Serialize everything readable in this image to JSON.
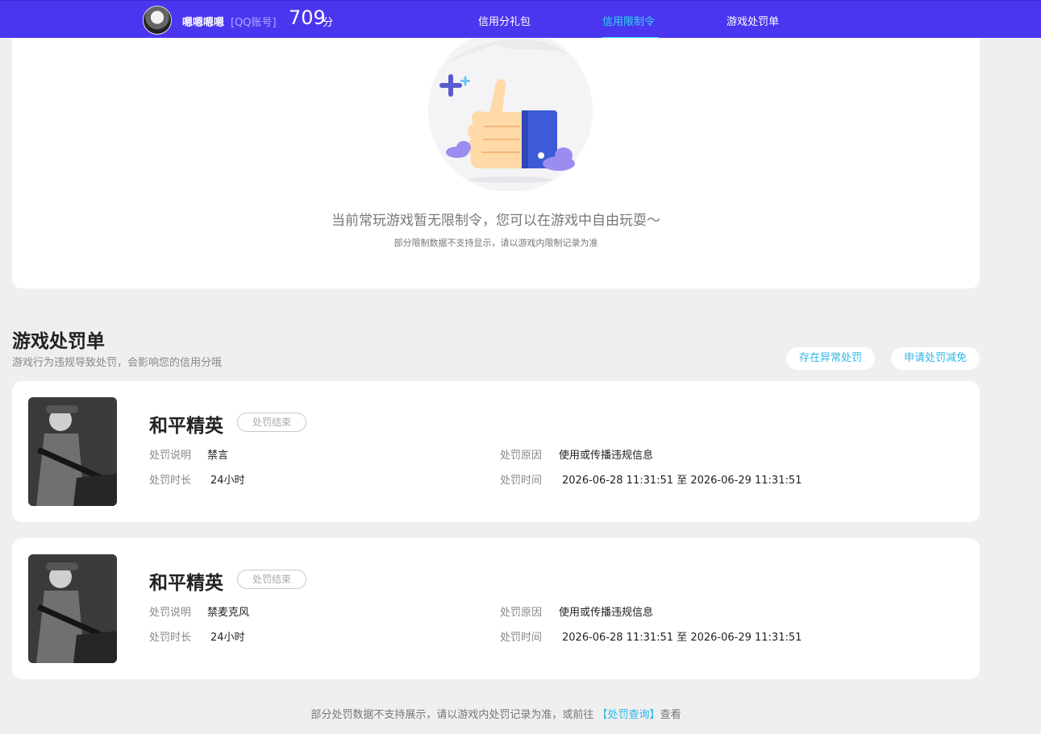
{
  "header": {
    "nickname": "嗯嗯嗯嗯",
    "account_type": "[QQ账号]",
    "score": "709",
    "score_unit": "分",
    "tabs": [
      {
        "label": "信用分礼包",
        "active": false
      },
      {
        "label": "信用限制令",
        "active": true
      },
      {
        "label": "游戏处罚单",
        "active": false
      }
    ]
  },
  "empty_state": {
    "title": "当前常玩游戏暂无限制令，您可以在游戏中自由玩耍～",
    "subtitle": "部分限制数据不支持显示，请以游戏内限制记录为准"
  },
  "penalty_section": {
    "title": "游戏处罚单",
    "subtitle": "游戏行为违规导致处罚，会影响您的信用分哦",
    "buttons": {
      "abnormal": "存在异常处罚",
      "reduce": "申请处罚减免"
    },
    "labels": {
      "desc": "处罚说明",
      "duration": "处罚时长",
      "reason": "处罚原因",
      "time": "处罚时间"
    },
    "items": [
      {
        "game": "和平精英",
        "status": "处罚结束",
        "desc": "禁言",
        "duration": "24小时",
        "reason": "使用或传播违规信息",
        "time": "2026-06-28 11:31:51 至 2026-06-29 11:31:51"
      },
      {
        "game": "和平精英",
        "status": "处罚结束",
        "desc": "禁麦克风",
        "duration": "24小时",
        "reason": "使用或传播违规信息",
        "time": "2026-06-28 11:31:51 至 2026-06-29 11:31:51"
      }
    ]
  },
  "footer": {
    "prefix": "部分处罚数据不支持展示，请以游戏内处罚记录为准，或前往 ",
    "link": "【处罚查询】",
    "suffix": "查看"
  },
  "colors": {
    "nav_bg": "#4b36f0",
    "active_tab": "#2fd8f0",
    "link": "#2fb7e8"
  }
}
